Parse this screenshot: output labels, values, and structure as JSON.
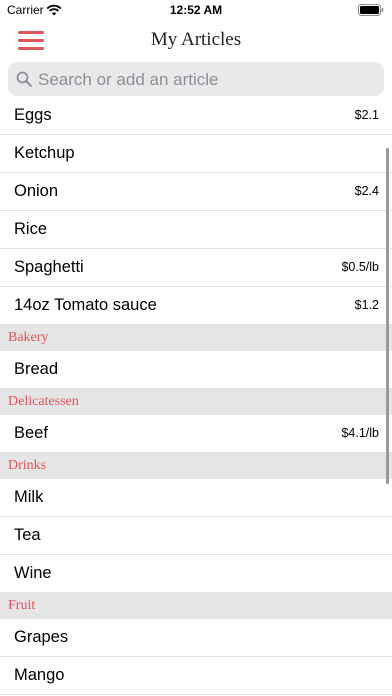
{
  "status_bar": {
    "carrier": "Carrier",
    "time": "12:52 AM"
  },
  "navbar": {
    "title": "My Articles",
    "menu_icon": "hamburger-menu-icon"
  },
  "search": {
    "placeholder": "Search or add an article",
    "value": ""
  },
  "list": {
    "rows_top": [
      {
        "name": "Eggs",
        "price": "$2.1"
      },
      {
        "name": "Ketchup",
        "price": ""
      },
      {
        "name": "Onion",
        "price": "$2.4"
      },
      {
        "name": "Rice",
        "price": ""
      },
      {
        "name": "Spaghetti",
        "price": "$0.5/lb"
      },
      {
        "name": "14oz Tomato sauce",
        "price": "$1.2"
      }
    ],
    "sections": [
      {
        "title": "Bakery",
        "items": [
          {
            "name": "Bread",
            "price": ""
          }
        ]
      },
      {
        "title": "Delicatessen",
        "items": [
          {
            "name": "Beef",
            "price": "$4.1/lb"
          }
        ]
      },
      {
        "title": "Drinks",
        "items": [
          {
            "name": "Milk",
            "price": ""
          },
          {
            "name": "Tea",
            "price": ""
          },
          {
            "name": "Wine",
            "price": ""
          }
        ]
      },
      {
        "title": "Fruit",
        "items": [
          {
            "name": "Grapes",
            "price": ""
          },
          {
            "name": "Mango",
            "price": ""
          }
        ]
      }
    ]
  },
  "colors": {
    "accent": "#e0545a",
    "section_bg": "#e5e5e5",
    "search_bg": "#e9e9eb"
  }
}
